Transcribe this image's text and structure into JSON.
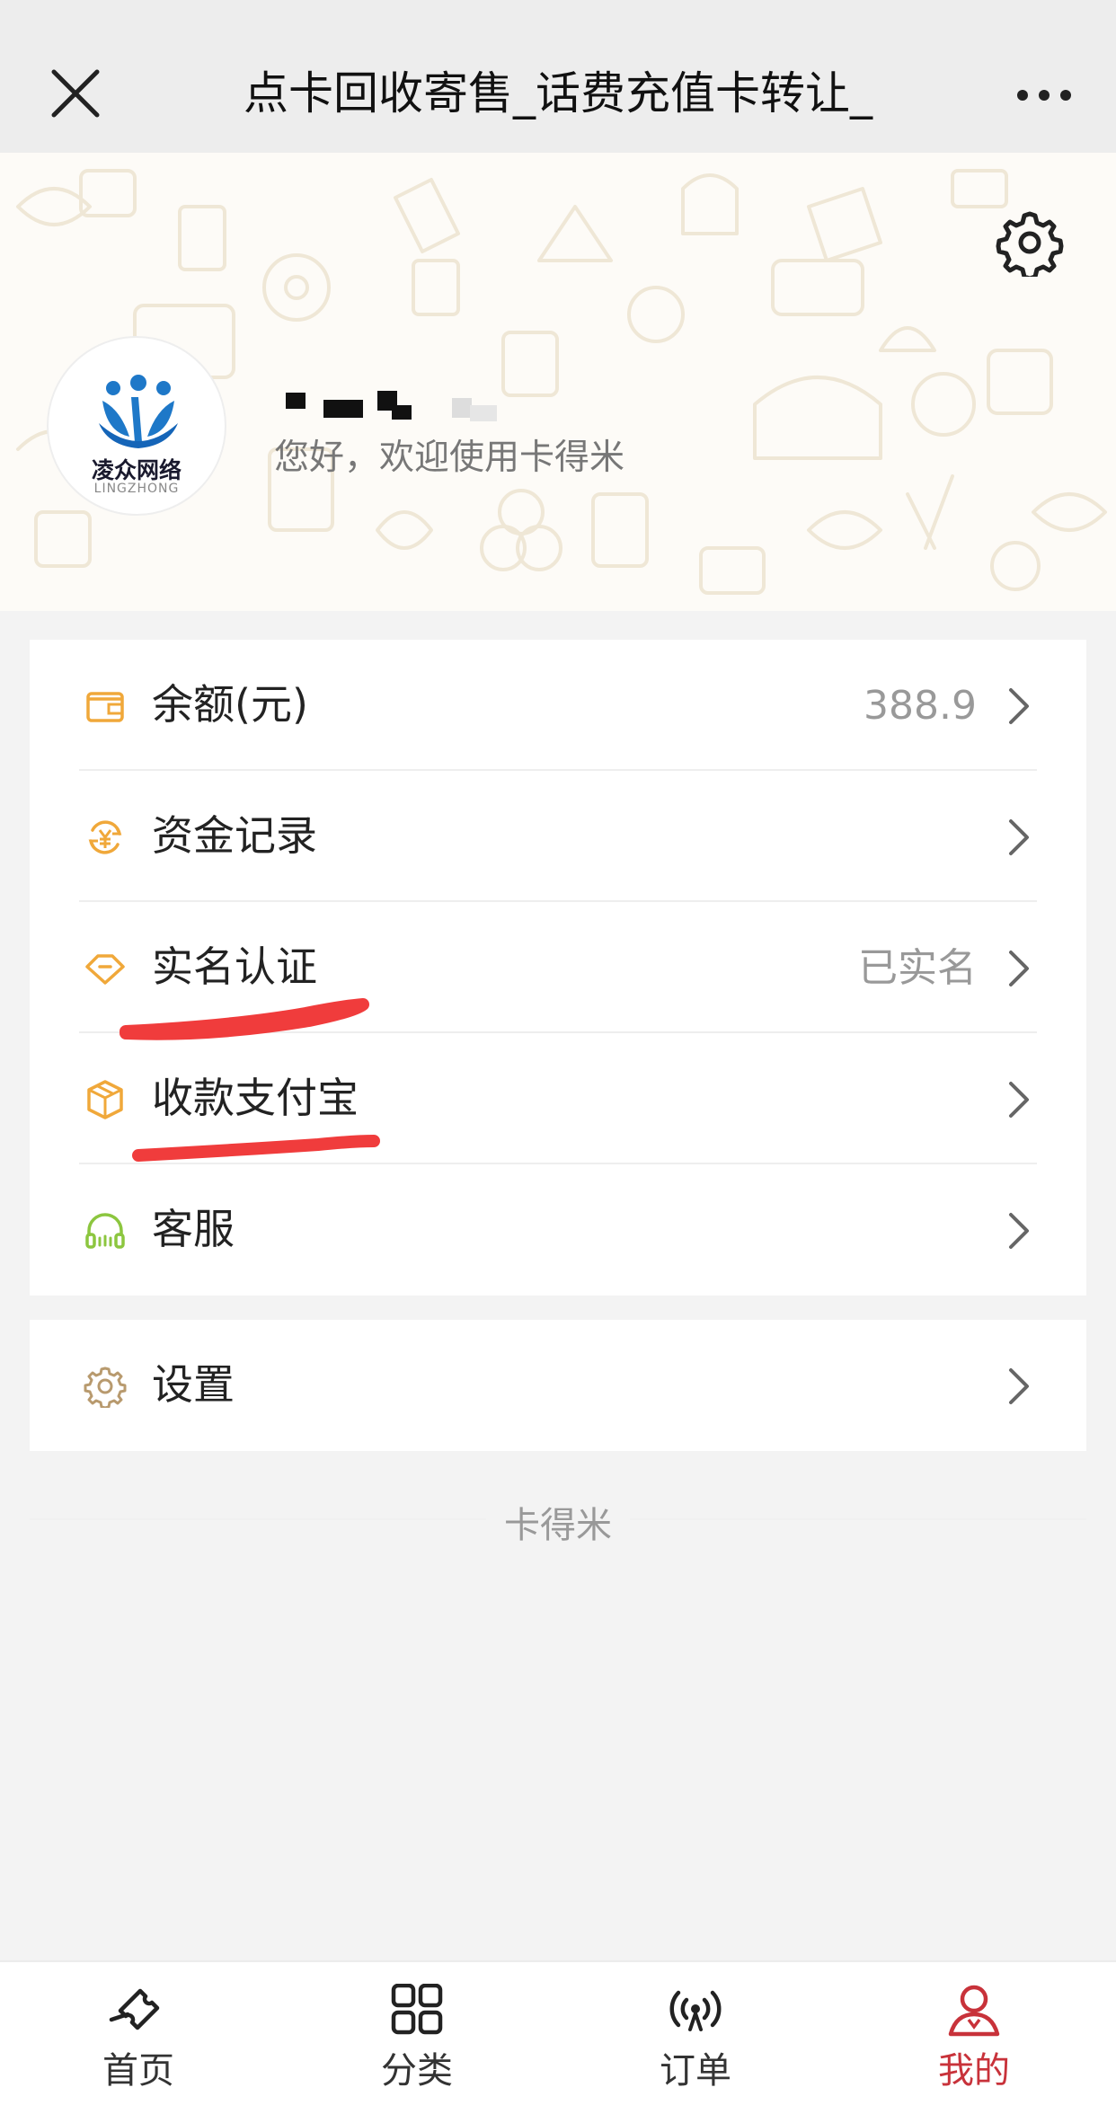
{
  "titlebar": {
    "title": "点卡回收寄售_话费充值卡转让_"
  },
  "profile": {
    "avatar_logo_cn": "凌众网络",
    "avatar_logo_en": "LINGZHONG",
    "greeting": "您好，欢迎使用卡得米"
  },
  "menu": {
    "balance": {
      "label": "余额(元)",
      "value": "388.9"
    },
    "records": {
      "label": "资金记录"
    },
    "verify": {
      "label": "实名认证",
      "value": "已实名"
    },
    "alipay": {
      "label": "收款支付宝"
    },
    "service": {
      "label": "客服"
    },
    "settings": {
      "label": "设置"
    }
  },
  "footer": {
    "brand": "卡得米"
  },
  "tabs": [
    {
      "label": "首页",
      "icon": "home-ticket-icon"
    },
    {
      "label": "分类",
      "icon": "grid-icon"
    },
    {
      "label": "订单",
      "icon": "broadcast-icon"
    },
    {
      "label": "我的",
      "icon": "user-icon",
      "active": true
    }
  ],
  "colors": {
    "accent": "#c8323a",
    "icon_orange": "#f0a83a",
    "icon_green": "#8cc63f",
    "icon_brown": "#b89a6e",
    "annotation_red": "#f03c3c"
  }
}
